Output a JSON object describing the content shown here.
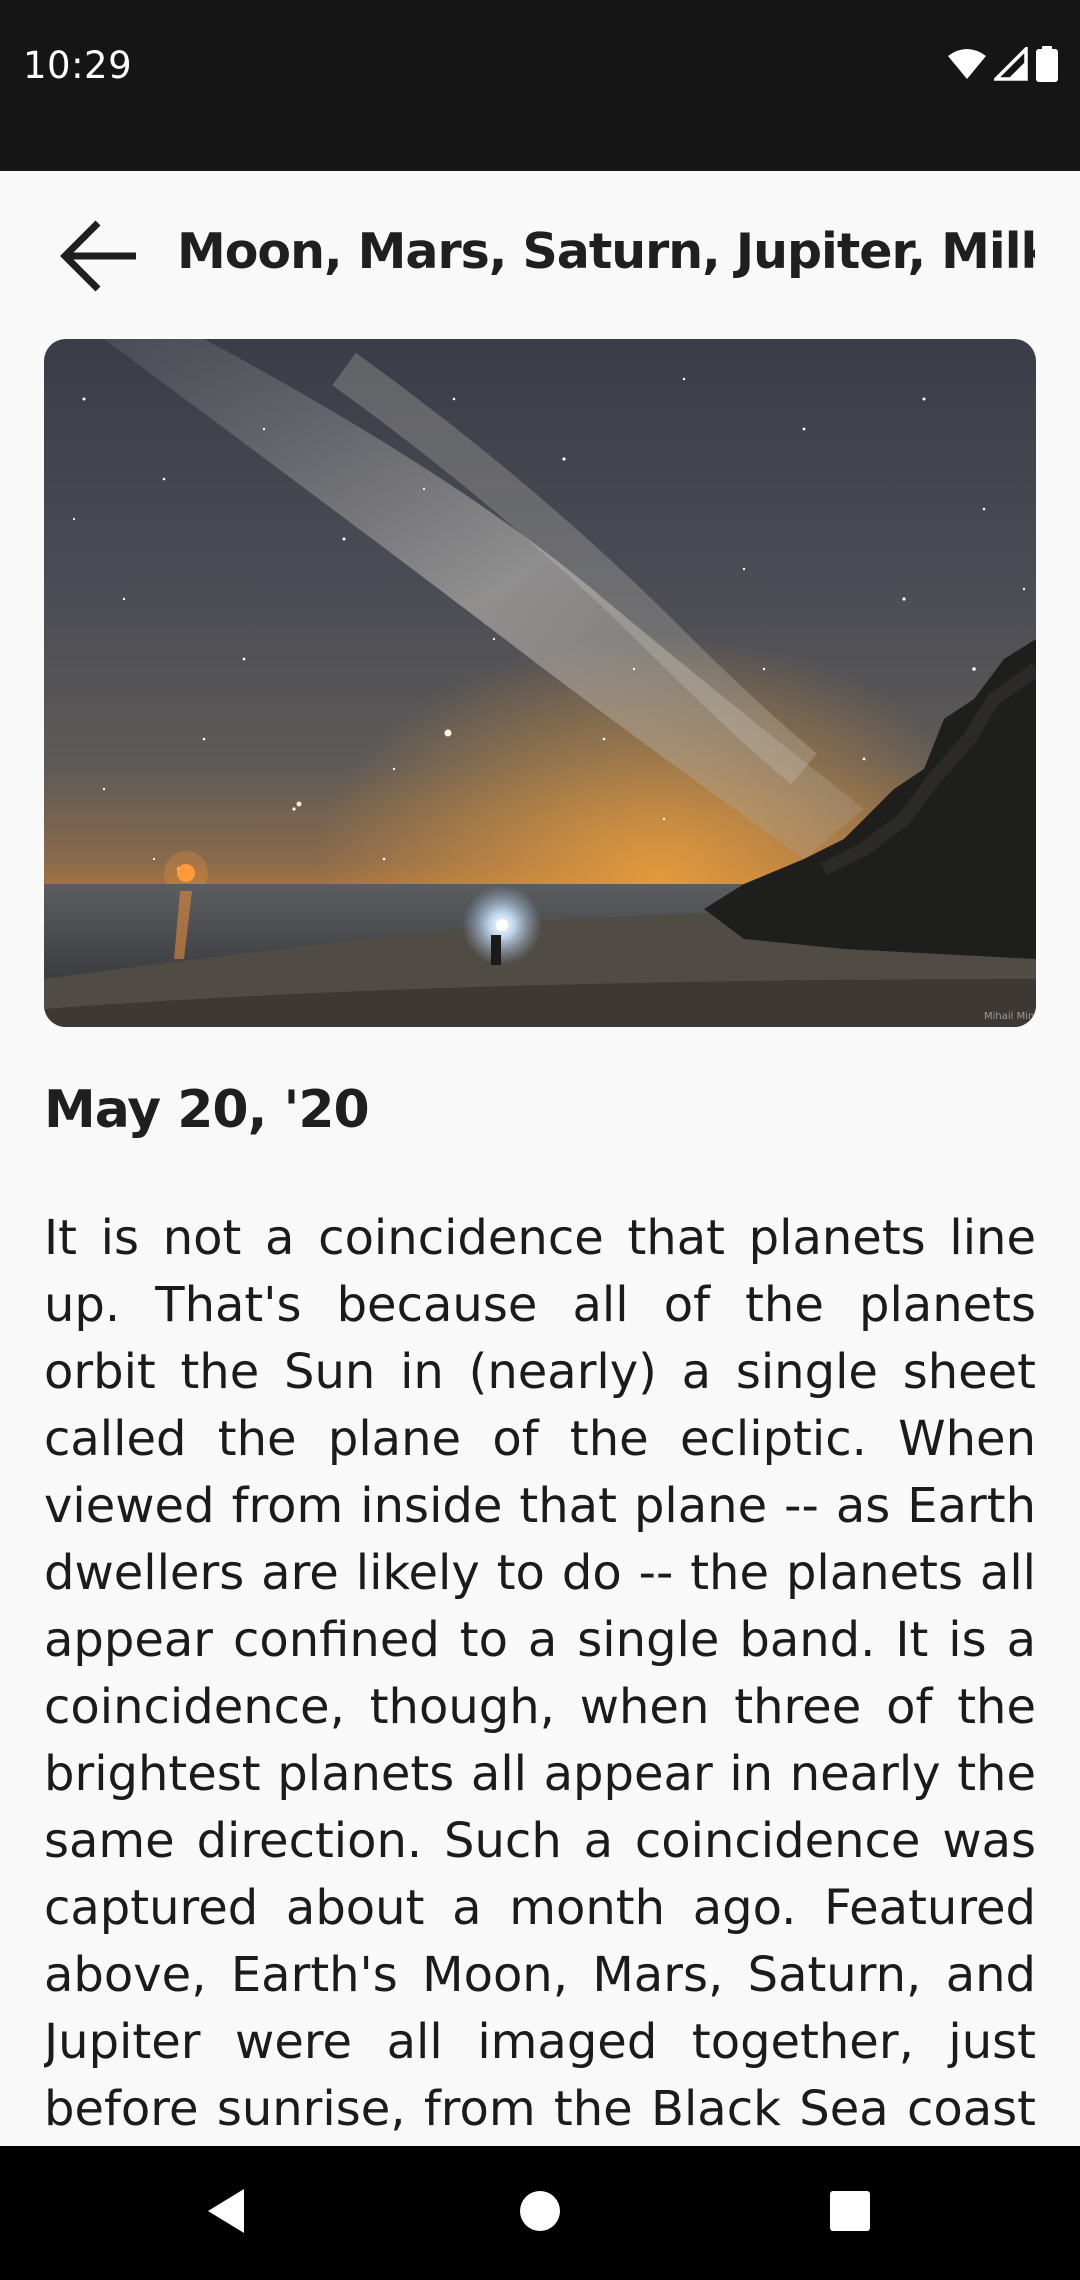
{
  "status_bar": {
    "time": "10:29",
    "icons": [
      "wifi-icon",
      "cell-signal-icon",
      "battery-icon"
    ]
  },
  "header": {
    "back_icon": "arrow-back-icon",
    "title": "Moon, Mars, Saturn, Jupiter, Milky Way"
  },
  "hero": {
    "watermark": "Mihail Mino"
  },
  "post": {
    "date": "May 20, '20",
    "body": "It is not a coincidence that planets line up. That's because all of the planets orbit the Sun in (nearly) a single sheet called the plane of the ecliptic. When viewed from inside that plane -- as Earth dwellers are likely to do -- the planets all appear confined to a single band. It is a coincidence, though, when three of the brightest planets all appear in nearly the same direction.  Such a coincidence was captured about a month ago. Featured above, Earth's Moon, Mars, Saturn, and Jupiter were all imaged together, just before sunrise, from the Black Sea coast of"
  },
  "nav_bar": {
    "buttons": [
      "back-triangle-icon",
      "home-circle-icon",
      "recents-square-icon"
    ]
  },
  "colors": {
    "status_bar_bg": "#151515",
    "page_bg": "#f9f9fa",
    "text": "#1b1b1b",
    "nav_bar_bg": "#000000"
  }
}
